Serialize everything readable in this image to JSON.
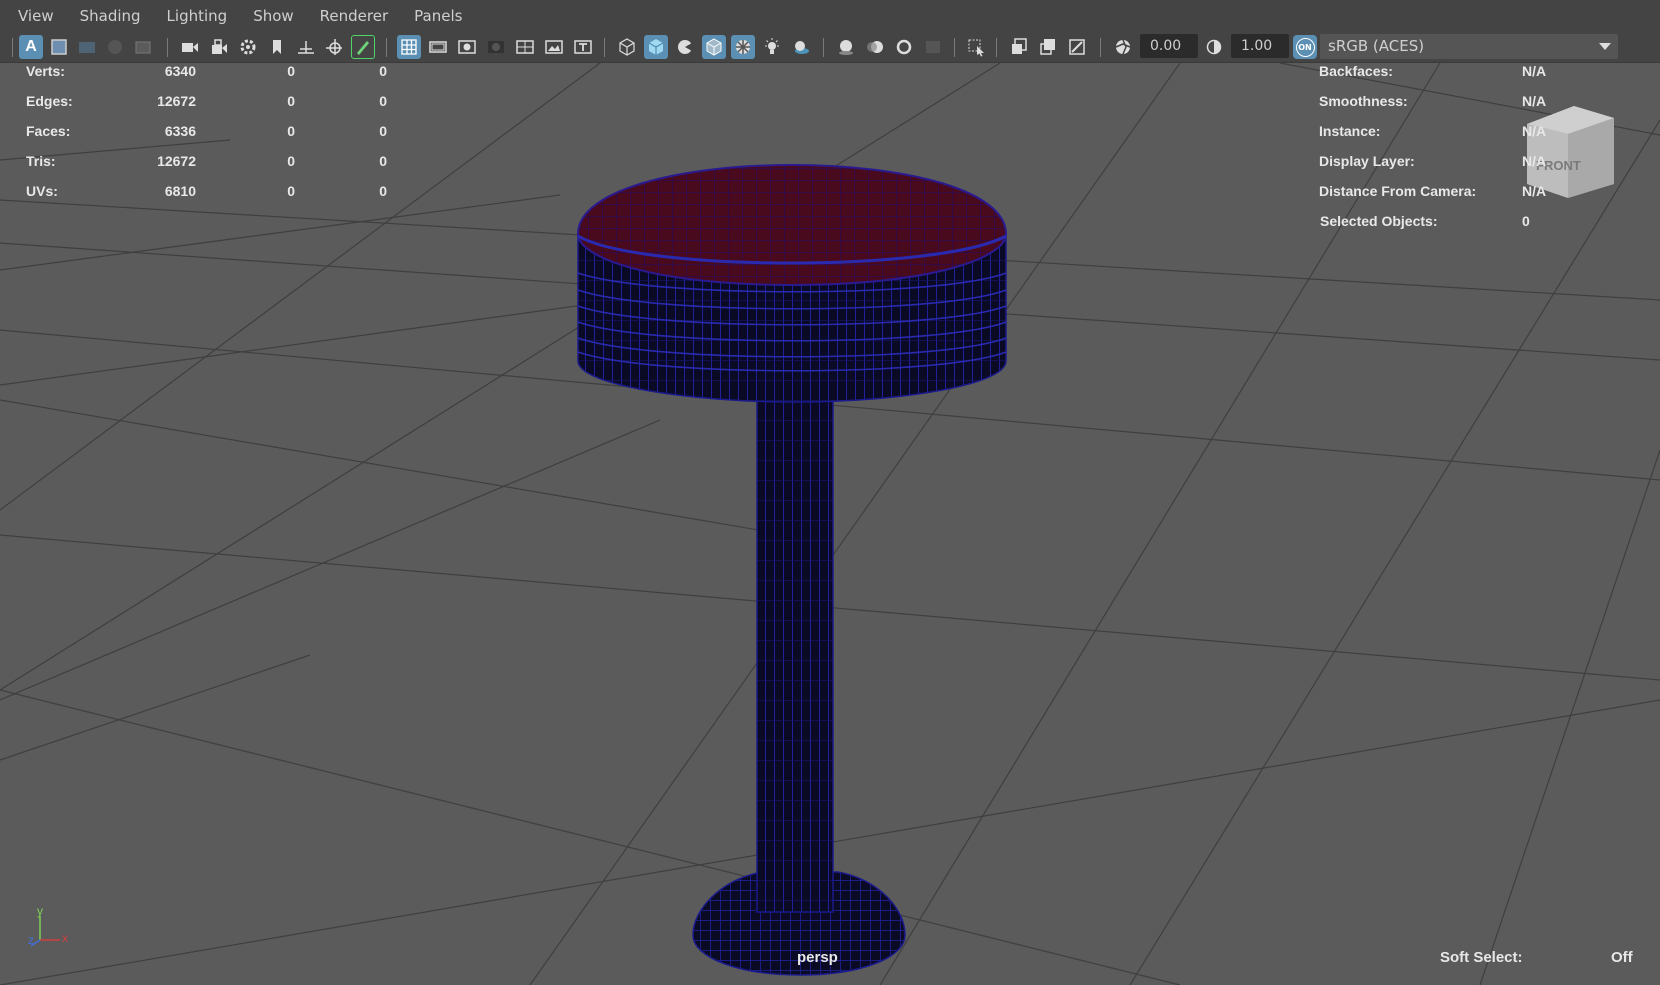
{
  "menu": [
    "View",
    "Shading",
    "Lighting",
    "Show",
    "Renderer",
    "Panels"
  ],
  "toolbar": {
    "icons": [
      "select-camera-icon",
      "camera-attributes-icon",
      "bookmark-icon",
      "image-plane-icon",
      "film-gate-icon",
      "grease-pencil-icon",
      "grid-icon",
      "film-gate-frame-icon",
      "resolution-gate-icon",
      "gate-mask-icon",
      "field-chart-icon",
      "safe-action-icon",
      "safe-title-icon",
      "wireframe-icon",
      "smooth-shade-icon",
      "use-default-material-icon",
      "wireframe-on-shaded-icon",
      "xray-icon",
      "use-all-lights-icon",
      "shadows-icon",
      "screen-space-ao-icon",
      "motion-blur-icon",
      "multisample-aa-icon",
      "depth-of-field-icon",
      "isolate-select-icon",
      "xray-joints-icon",
      "xray-active-components-icon",
      "backface-culling-icon",
      "exposure-icon",
      "gamma-icon",
      "color-management-toggle-icon"
    ],
    "exposure": "0.00",
    "gamma": "1.00",
    "colorspace": "sRGB (ACES)",
    "cm_toggle": "ON"
  },
  "hud_left": [
    {
      "label": "Verts:",
      "v1": "6340",
      "v2": "0",
      "v3": "0"
    },
    {
      "label": "Edges:",
      "v1": "12672",
      "v2": "0",
      "v3": "0"
    },
    {
      "label": "Faces:",
      "v1": "6336",
      "v2": "0",
      "v3": "0"
    },
    {
      "label": "Tris:",
      "v1": "12672",
      "v2": "0",
      "v3": "0"
    },
    {
      "label": "UVs:",
      "v1": "6810",
      "v2": "0",
      "v3": "0"
    }
  ],
  "hud_right": [
    {
      "label": "Backfaces:",
      "value": "N/A"
    },
    {
      "label": "Smoothness:",
      "value": "N/A"
    },
    {
      "label": "Instance:",
      "value": "N/A"
    },
    {
      "label": "Display Layer:",
      "value": "N/A"
    },
    {
      "label": "Distance From Camera:",
      "value": "N/A"
    },
    {
      "label": "Selected Objects:",
      "value": "0"
    }
  ],
  "viewcube_label": "FRONT",
  "camera": "persp",
  "soft_select": {
    "label": "Soft Select:",
    "value": "Off"
  },
  "axes": {
    "y": "y",
    "z": "z",
    "x": "x"
  },
  "colors": {
    "seat_top": "#4a0a1e",
    "wire": "#1a1a8c",
    "stool_body": "#0a0a24",
    "active_button": "#5b8fb3",
    "viewport_bg": "#5b5b5b"
  }
}
